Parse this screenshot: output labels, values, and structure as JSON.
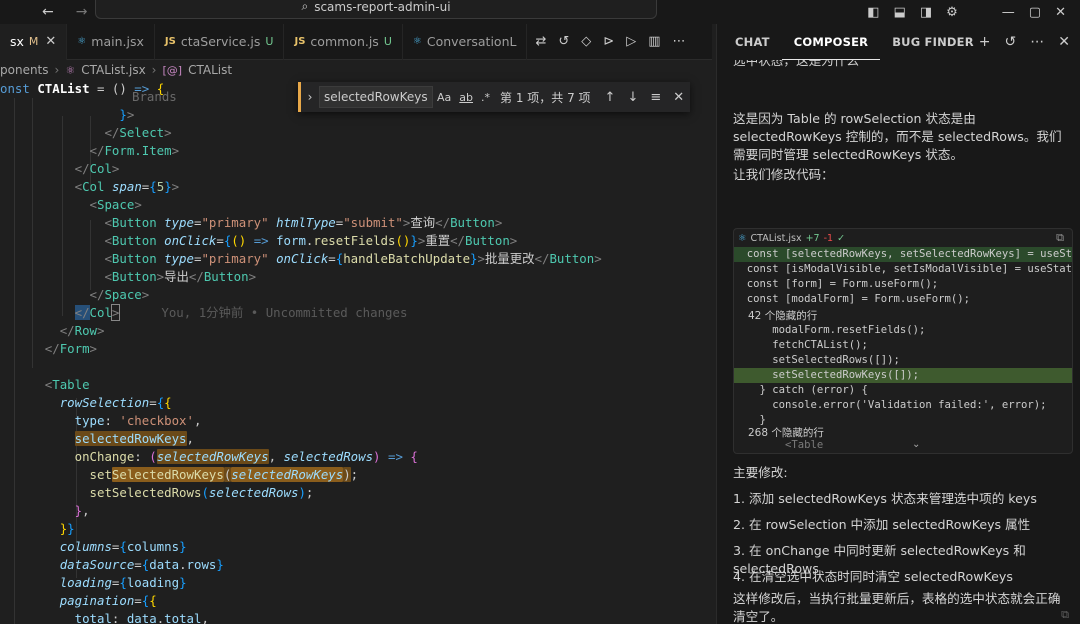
{
  "titlebar": {
    "back": "←",
    "forward": "→",
    "search": "scams-report-admin-ui",
    "controls": [
      "⧉",
      "▢",
      "▣",
      "⚙",
      "—",
      "▢",
      "✕"
    ]
  },
  "tabs": [
    {
      "label": "sx",
      "status": "M",
      "active": true,
      "close": "✕"
    },
    {
      "label": "main.jsx",
      "icon": "⚛",
      "status": ""
    },
    {
      "label": "ctaService.js",
      "icon": "JS",
      "status": "U"
    },
    {
      "label": "common.js",
      "icon": "JS",
      "status": "U"
    },
    {
      "label": "ConversationL",
      "icon": "⚛",
      "status": ""
    }
  ],
  "breadcrumb": {
    "segments": [
      "ponents",
      "CTAList.jsx",
      "CTAList"
    ]
  },
  "find": {
    "value": "selectedRowKeys",
    "opt_case": "Aa",
    "opt_word": "ab",
    "opt_regex": ".*",
    "count": "第 1 项，共 7 项"
  },
  "editor": {
    "blame": "You, 1分钟前 • Uncommitted changes"
  },
  "panel": {
    "tabs": [
      "CHAT",
      "COMPOSER",
      "BUG FINDER"
    ],
    "active_tab": "COMPOSER",
    "top_cut": "选中状态，这是为什么",
    "para1": "这是因为 Table 的 rowSelection 状态是由 selectedRowKeys 控制的，而不是 selectedRows。我们需要同时管理 selectedRowKeys 状态。",
    "para2": "让我们修改代码：",
    "code_header": {
      "file": "CTAList.jsx",
      "added": "+7",
      "removed": "-1",
      "check": "✓"
    },
    "code_lines": [
      "  const [selectedRowKeys, setSelectedRowKeys] = useSta",
      "  const [isModalVisible, setIsModalVisible] = useState",
      "  const [form] = Form.useForm();",
      "  const [modalForm] = Form.useForm();"
    ],
    "hidden1": "42 个隐藏的行",
    "code_lines2": [
      "      modalForm.resetFields();",
      "      fetchCTAList();",
      "      setSelectedRows([]);",
      "      setSelectedRowKeys([]);",
      "    } catch (error) {",
      "      console.error('Validation failed:', error);",
      "    }"
    ],
    "hidden2": "268 个隐藏的行",
    "code_tail": "        <Table",
    "summary_title": "主要修改:",
    "list": [
      "1. 添加 selectedRowKeys 状态来管理选中项的 keys",
      "2. 在 rowSelection 中添加 selectedRowKeys 属性",
      "3. 在 onChange 中同时更新 selectedRowKeys 和 selectedRows",
      "4. 在清空选中状态时同时清空 selectedRowKeys"
    ],
    "conclusion": "这样修改后，当执行批量更新后，表格的选中状态就会正确清空了。"
  }
}
